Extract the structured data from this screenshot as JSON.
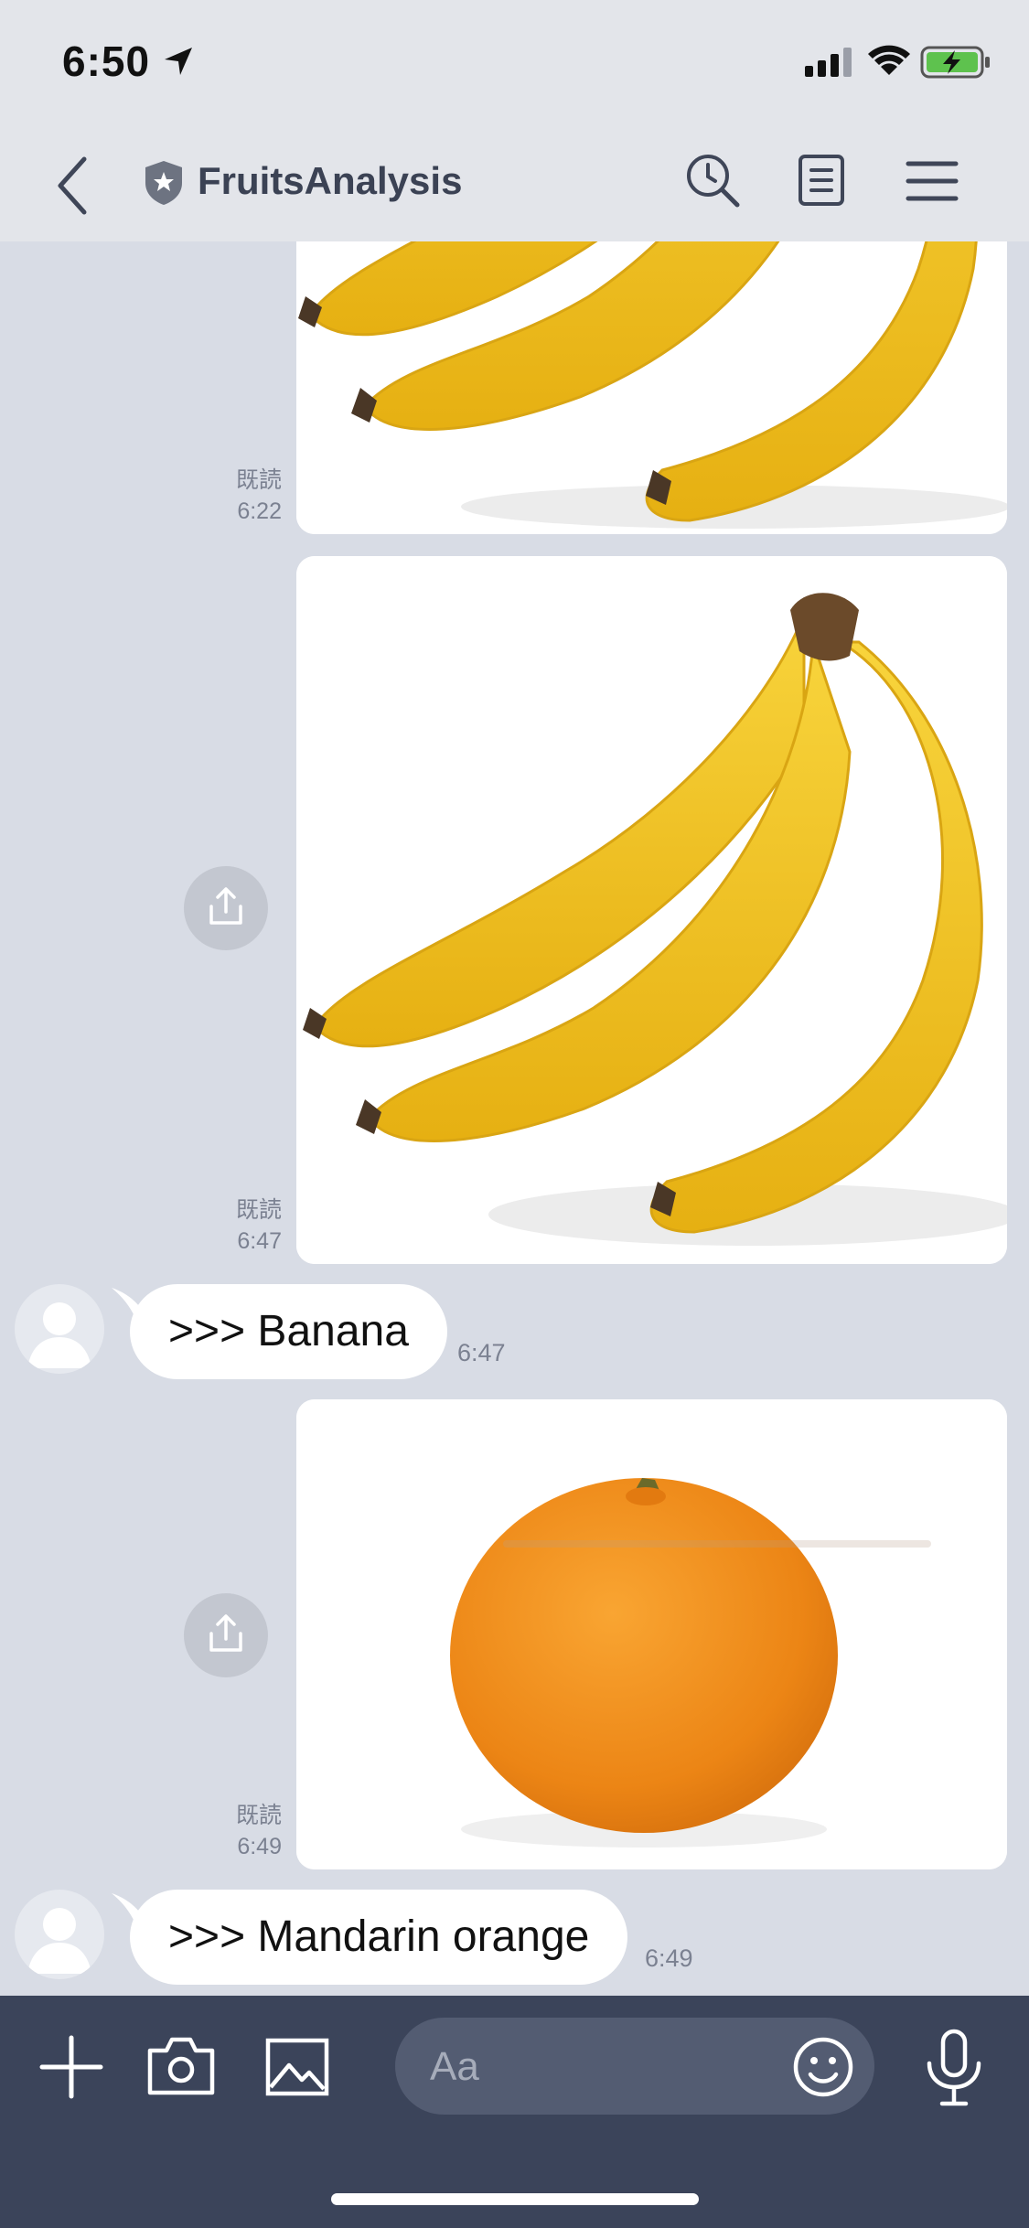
{
  "status_bar": {
    "time": "6:50"
  },
  "header": {
    "title": "FruitsAnalysis",
    "icons": [
      "back-icon",
      "shield-icon",
      "search-icon",
      "notes-icon",
      "menu-icon"
    ]
  },
  "messages": [
    {
      "type": "image-sent",
      "image": "banana-bunch",
      "read_label": "既読",
      "time": "6:22"
    },
    {
      "type": "image-sent",
      "image": "banana-bunch",
      "read_label": "既読",
      "time": "6:47"
    },
    {
      "type": "text-received",
      "text": ">>> Banana",
      "time": "6:47"
    },
    {
      "type": "image-sent",
      "image": "mandarin-orange",
      "read_label": "既読",
      "time": "6:49"
    },
    {
      "type": "text-received",
      "text": ">>> Mandarin orange",
      "time": "6:49"
    }
  ],
  "input_bar": {
    "placeholder": "Aa",
    "icons": [
      "plus-icon",
      "camera-icon",
      "gallery-icon",
      "emoji-icon",
      "mic-icon"
    ]
  },
  "colors": {
    "background": "#d8dce5",
    "header": "#e3e5ea",
    "input_bar": "#3b445a",
    "bubble": "#ffffff",
    "banana": "#f2c21c",
    "orange": "#f08c1c"
  }
}
